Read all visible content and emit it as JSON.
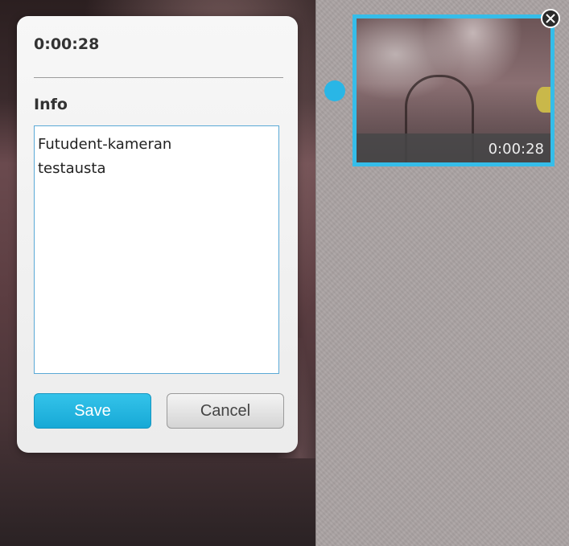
{
  "popup": {
    "time": "0:00:28",
    "info_label": "Info",
    "info_text": "Futudent-kameran\ntestausta",
    "save_label": "Save",
    "cancel_label": "Cancel"
  },
  "thumbnail": {
    "time": "0:00:28"
  },
  "colors": {
    "accent": "#29b6e6",
    "save_button": "#1fb1dd"
  },
  "icons": {
    "close": "close-icon",
    "marker": "marker-dot-icon"
  }
}
